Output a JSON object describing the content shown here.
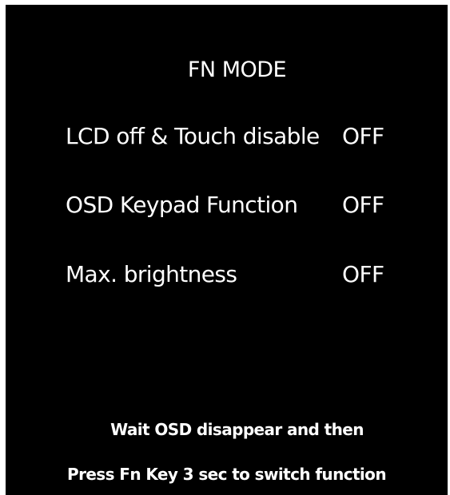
{
  "osd": {
    "title": "FN MODE",
    "rows": [
      {
        "label": "LCD off & Touch disable",
        "value": "OFF"
      },
      {
        "label": "OSD Keypad Function",
        "value": "OFF"
      },
      {
        "label": "Max. brightness",
        "value": "OFF"
      }
    ],
    "instructions": [
      "Wait OSD disappear and then",
      "Press Fn Key 3 sec to switch function"
    ]
  },
  "colors": {
    "background": "#000000",
    "text": "#ffffff"
  }
}
